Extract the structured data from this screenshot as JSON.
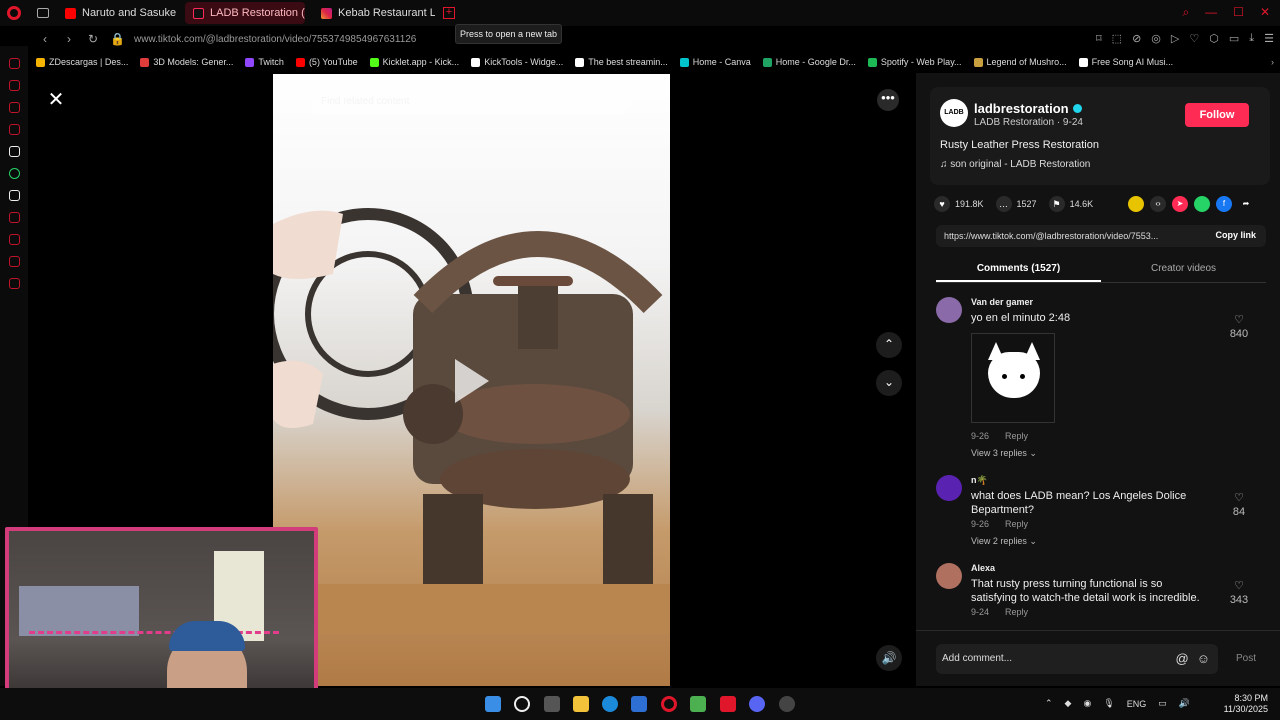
{
  "browser": {
    "tabs": [
      {
        "label": "Naruto and Sasuke vs Mo",
        "favicon": "youtube-icon",
        "active": false
      },
      {
        "label": "LADB Restoration (@ladb",
        "favicon": "tiktok-icon",
        "active": true
      },
      {
        "label": "Kebab Restaurant Llagost",
        "favicon": "instagram-icon",
        "active": false
      }
    ],
    "newtab_glyph": "+",
    "tooltip": "Press to open a new tab",
    "url": "www.tiktok.com/@ladbrestoration/video/7553749854967631126",
    "bookmarks": [
      {
        "label": "ZDescargas | Des...",
        "color": "#f4b400"
      },
      {
        "label": "3D Models: Gener...",
        "color": "#e03c3c"
      },
      {
        "label": "Twitch",
        "color": "#9146ff"
      },
      {
        "label": "(5) YouTube",
        "color": "#ff0000"
      },
      {
        "label": "Kicklet.app - Kick...",
        "color": "#53fc18"
      },
      {
        "label": "KickTools - Widge...",
        "color": "#ffffff"
      },
      {
        "label": "The best streamin...",
        "color": "#ffffff"
      },
      {
        "label": "Home - Canva",
        "color": "#00c4cc"
      },
      {
        "label": "Home - Google Dr...",
        "color": "#1fa463"
      },
      {
        "label": "Spotify - Web Play...",
        "color": "#1db954"
      },
      {
        "label": "Legend of Mushro...",
        "color": "#c8a040"
      },
      {
        "label": "Free Song AI Musi...",
        "color": "#ffffff"
      }
    ]
  },
  "video": {
    "search_placeholder": "Find related content",
    "close_glyph": "✕",
    "more_glyph": "•••",
    "up_glyph": "⌃",
    "down_glyph": "⌄",
    "volume_glyph": "🔊"
  },
  "panel": {
    "author_handle": "ladbrestoration",
    "author_avatar_text": "LADB",
    "author_sub": "LADB Restoration · 9-24",
    "follow_label": "Follow",
    "title": "Rusty Leather Press Restoration",
    "music": "son original - LADB Restoration",
    "stats": {
      "likes": "191.8K",
      "comments": "1527",
      "saves": "14.6K"
    },
    "share_link": "https://www.tiktok.com/@ladbrestoration/video/7553...",
    "copy_label": "Copy link",
    "tab_comments": "Comments (1527)",
    "tab_creator": "Creator videos",
    "comments": [
      {
        "user": "Van der gamer",
        "text": "yo en el minuto 2:48",
        "date": "9-26",
        "reply": "Reply",
        "likes": "840",
        "replies": "View 3 replies",
        "avatar": "#8a6aa8"
      },
      {
        "user": "n🌴",
        "text": "what does LADB mean? Los Angeles Dolice Bepartment?",
        "date": "9-26",
        "reply": "Reply",
        "likes": "84",
        "replies": "View 2 replies",
        "avatar": "#5a22b0"
      },
      {
        "user": "Alexa",
        "text": "That rusty press turning functional is so satisfying to watch-the detail work is incredible.",
        "date": "9-24",
        "reply": "Reply",
        "likes": "343",
        "replies": "",
        "avatar": "#b07060"
      }
    ],
    "add_comment": "Add comment...",
    "at_glyph": "@",
    "emoji_glyph": "☺",
    "post_label": "Post"
  },
  "taskbar": {
    "lang": "ENG",
    "time": "8:30 PM",
    "date": "11/30/2025"
  }
}
